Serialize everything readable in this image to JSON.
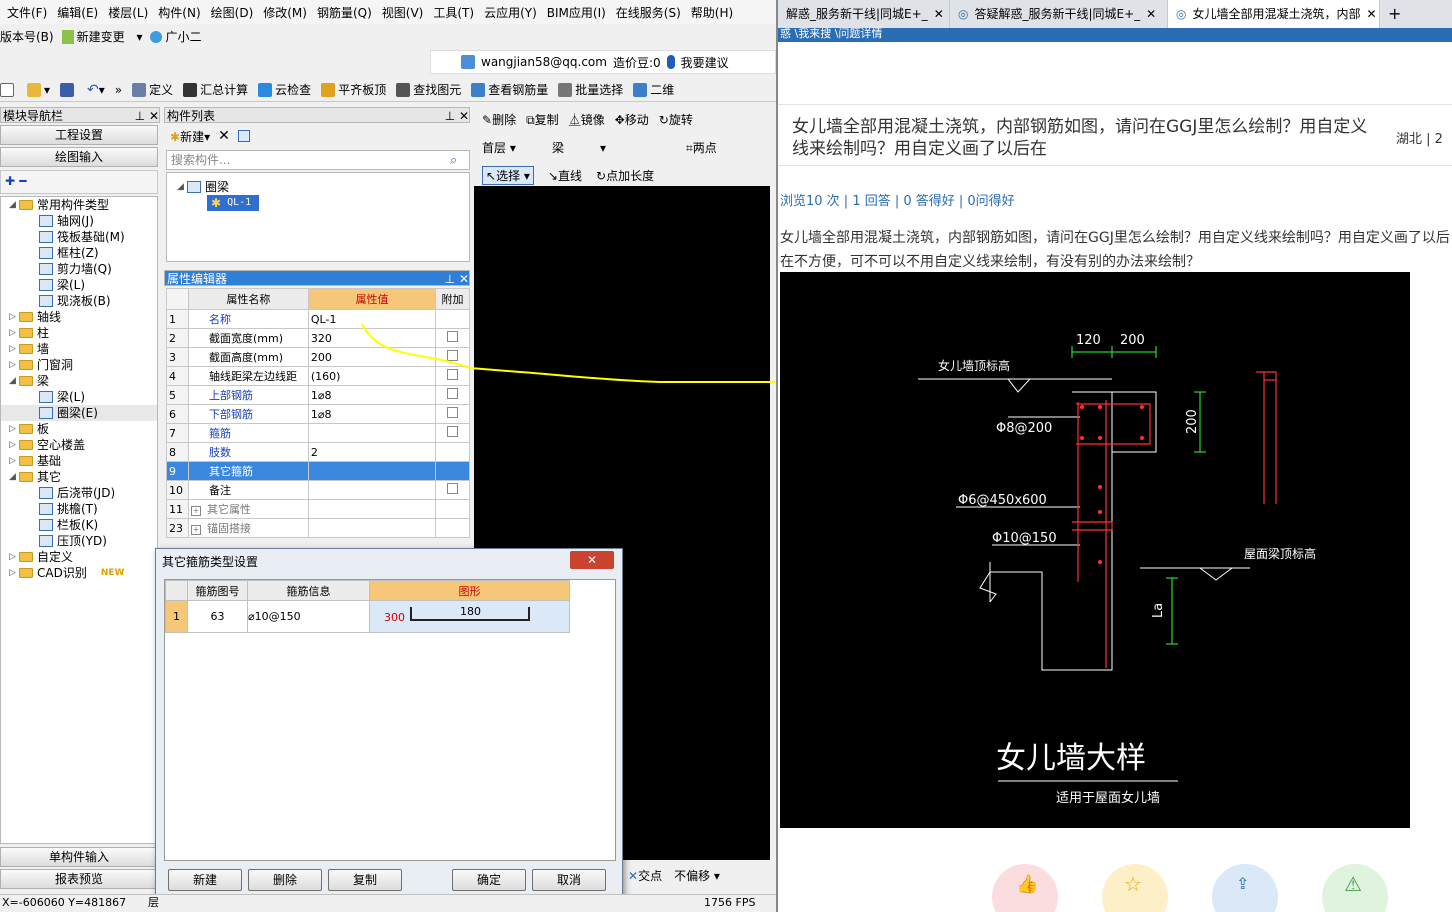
{
  "menu": [
    "文件(F)",
    "编辑(E)",
    "楼层(L)",
    "构件(N)",
    "绘图(D)",
    "修改(M)",
    "钢筋量(Q)",
    "视图(V)",
    "工具(T)",
    "云应用(Y)",
    "BIM应用(I)",
    "在线服务(S)",
    "帮助(H)"
  ],
  "row2": {
    "version": "版本号(B)",
    "change": "新建变更",
    "assistant": "广小二"
  },
  "userbar": {
    "email": "wangjian58@qq.com",
    "beans": "造价豆:0",
    "suggest": "我要建议"
  },
  "toolbar": [
    "定义",
    "汇总计算",
    "云检查",
    "平齐板顶",
    "查找图元",
    "查看钢筋量",
    "批量选择",
    "二维"
  ],
  "nav": {
    "title": "模块导航栏",
    "project": "工程设置",
    "draw": "绘图输入",
    "single": "单构件输入",
    "report": "报表预览"
  },
  "tree": [
    {
      "label": "常用构件类型",
      "level": 0,
      "type": "folder",
      "open": true
    },
    {
      "label": "轴网(J)",
      "level": 1,
      "type": "leaf"
    },
    {
      "label": "筏板基础(M)",
      "level": 1,
      "type": "leaf"
    },
    {
      "label": "框柱(Z)",
      "level": 1,
      "type": "leaf"
    },
    {
      "label": "剪力墙(Q)",
      "level": 1,
      "type": "leaf"
    },
    {
      "label": "梁(L)",
      "level": 1,
      "type": "leaf"
    },
    {
      "label": "现浇板(B)",
      "level": 1,
      "type": "leaf"
    },
    {
      "label": "轴线",
      "level": 0,
      "type": "folder"
    },
    {
      "label": "柱",
      "level": 0,
      "type": "folder"
    },
    {
      "label": "墙",
      "level": 0,
      "type": "folder"
    },
    {
      "label": "门窗洞",
      "level": 0,
      "type": "folder"
    },
    {
      "label": "梁",
      "level": 0,
      "type": "folder",
      "open": true
    },
    {
      "label": "梁(L)",
      "level": 1,
      "type": "leaf"
    },
    {
      "label": "圈梁(E)",
      "level": 1,
      "type": "leaf"
    },
    {
      "label": "板",
      "level": 0,
      "type": "folder"
    },
    {
      "label": "空心楼盖",
      "level": 0,
      "type": "folder"
    },
    {
      "label": "基础",
      "level": 0,
      "type": "folder"
    },
    {
      "label": "其它",
      "level": 0,
      "type": "folder",
      "open": true
    },
    {
      "label": "后浇带(JD)",
      "level": 1,
      "type": "leaf"
    },
    {
      "label": "挑檐(T)",
      "level": 1,
      "type": "leaf"
    },
    {
      "label": "栏板(K)",
      "level": 1,
      "type": "leaf"
    },
    {
      "label": "压顶(YD)",
      "level": 1,
      "type": "leaf"
    },
    {
      "label": "自定义",
      "level": 0,
      "type": "folder"
    },
    {
      "label": "CAD识别",
      "level": 0,
      "type": "folder",
      "badge": "NEW"
    }
  ],
  "complist": {
    "title": "构件列表",
    "new": "新建",
    "search_placeholder": "搜索构件...",
    "parent": "圈梁",
    "child": "QL-1"
  },
  "prop": {
    "title": "属性编辑器",
    "headers": [
      "属性名称",
      "属性值",
      "附加"
    ],
    "rows": [
      {
        "n": "1",
        "name": "名称",
        "value": "QL-1",
        "blue": true,
        "chk": false
      },
      {
        "n": "2",
        "name": "截面宽度(mm)",
        "value": "320",
        "blue": false,
        "chk": true
      },
      {
        "n": "3",
        "name": "截面高度(mm)",
        "value": "200",
        "blue": false,
        "chk": true
      },
      {
        "n": "4",
        "name": "轴线距梁左边线距",
        "value": "(160)",
        "blue": false,
        "chk": true
      },
      {
        "n": "5",
        "name": "上部钢筋",
        "value": "1⌀8",
        "blue": true,
        "chk": true
      },
      {
        "n": "6",
        "name": "下部钢筋",
        "value": "1⌀8",
        "blue": true,
        "chk": true
      },
      {
        "n": "7",
        "name": "箍筋",
        "value": "",
        "blue": true,
        "chk": true
      },
      {
        "n": "8",
        "name": "肢数",
        "value": "2",
        "blue": true,
        "chk": false
      },
      {
        "n": "9",
        "name": "其它箍筋",
        "value": "",
        "blue": false,
        "chk": false,
        "sel": true
      },
      {
        "n": "10",
        "name": "备注",
        "value": "",
        "blue": false,
        "chk": true
      },
      {
        "n": "11",
        "name": "其它属性",
        "value": "",
        "blue": false,
        "chk": false,
        "grp": true
      },
      {
        "n": "23",
        "name": "锚固搭接",
        "value": "",
        "blue": false,
        "chk": false,
        "grp": true
      }
    ]
  },
  "drawbar": {
    "delete": "删除",
    "copy": "复制",
    "mirror": "镜像",
    "move": "移动",
    "rotate": "旋转",
    "floor": "首层",
    "type": "梁",
    "twopt": "两点",
    "select": "选择",
    "line": "直线",
    "addlen": "点加长度",
    "cross": "交点",
    "nooffset": "不偏移"
  },
  "dialog": {
    "title": "其它箍筋类型设置",
    "headers": [
      "箍筋图号",
      "箍筋信息",
      "图形"
    ],
    "row": {
      "n": "1",
      "code": "63",
      "info": "⌀10@150",
      "shape_a": "300",
      "shape_b": "180"
    },
    "buttons": [
      "新建",
      "删除",
      "复制",
      "确定",
      "取消"
    ]
  },
  "status": {
    "coords": "X=-606060 Y=481867",
    "fps": "1756 FPS",
    "floor": "层"
  },
  "browser": {
    "tabs": [
      "解惑_服务新干线|同城E+_",
      "答疑解惑_服务新干线|同城E+_",
      "女儿墙全部用混凝土浇筑，内部"
    ],
    "crumb": "惑 \\我来搜 \\问题详情",
    "question": "女儿墙全部用混凝土浇筑，内部钢筋如图，请问在GGJ里怎么绘制？用自定义线来绘制吗？用自定义画了以后在",
    "location": "湖北 | 2",
    "stats": "浏览10 次 | 1 回答 | 0 答得好 | 0问得好",
    "body": "女儿墙全部用混凝土浇筑，内部钢筋如图，请问在GGJ里怎么绘制？用自定义线来绘制吗？用自定义画了以后在不方便，可不可以不用自定义线来绘制，有没有别的办法来绘制？"
  },
  "cad": {
    "dim1": "120",
    "dim2": "200",
    "dim3": "200",
    "lbl_top": "女儿墙顶标高",
    "lbl_a": "Φ8@200",
    "lbl_b": "Φ6@450x600",
    "lbl_c": "Φ10@150",
    "lbl_roof": "屋面梁顶标高",
    "la": "La",
    "title": "女儿墙大样",
    "subtitle": "适用于屋面女儿墙"
  },
  "colors": {
    "accent": "#2f7fd6",
    "highlight": "#ffff00",
    "cad_red": "#ff3030",
    "cad_green": "#33ff33"
  }
}
